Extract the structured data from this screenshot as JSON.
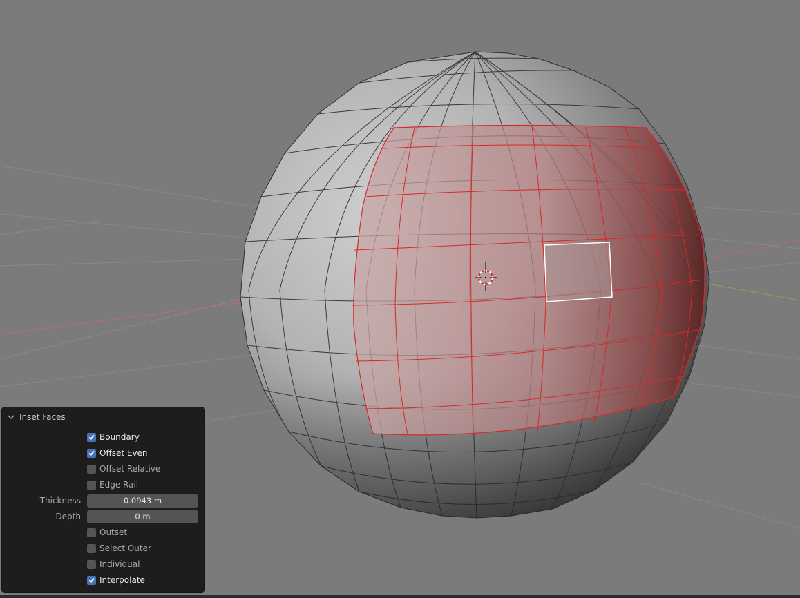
{
  "panel": {
    "title": "Inset Faces",
    "options": [
      {
        "label": "Boundary",
        "checked": true
      },
      {
        "label": "Offset Even",
        "checked": true
      },
      {
        "label": "Offset Relative",
        "checked": false
      },
      {
        "label": "Edge Rail",
        "checked": false
      }
    ],
    "thickness": {
      "label": "Thickness",
      "value": "0.0943 m"
    },
    "depth": {
      "label": "Depth",
      "value": "0 m"
    },
    "options2": [
      {
        "label": "Outset",
        "checked": false
      },
      {
        "label": "Select Outer",
        "checked": false
      },
      {
        "label": "Individual",
        "checked": false
      },
      {
        "label": "Interpolate",
        "checked": true
      }
    ]
  },
  "colors": {
    "viewport_bg": "#7b7b7b",
    "panel_bg": "#1d1d1d",
    "checkbox_on": "#4772b3",
    "selection_edge": "#d42a2a"
  }
}
